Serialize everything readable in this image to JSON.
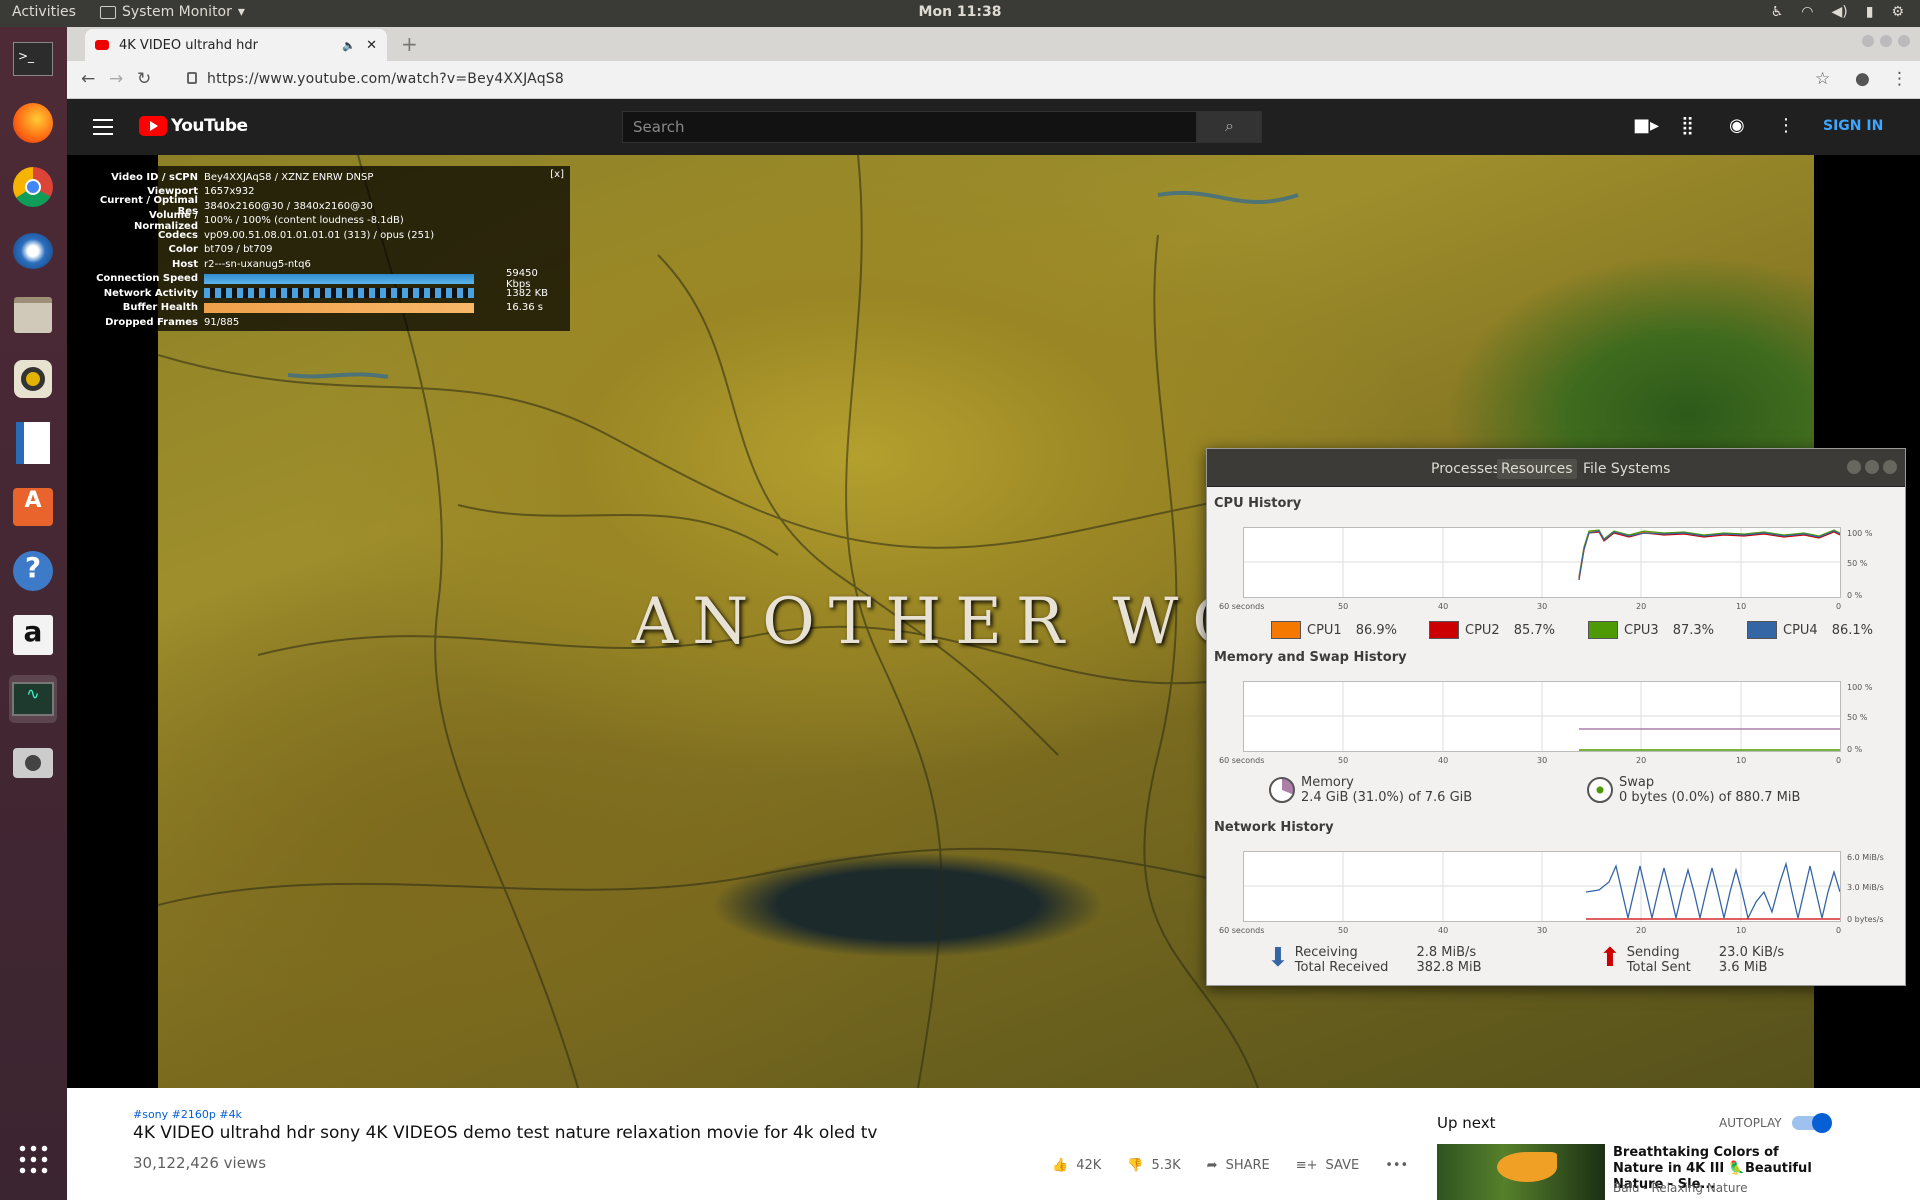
{
  "topbar": {
    "activities": "Activities",
    "app_name": "System Monitor",
    "clock": "Mon 11:38"
  },
  "launcher": {
    "items": [
      "terminal-icon",
      "firefox-icon",
      "chrome-icon",
      "thunderbird-icon",
      "files-icon",
      "rhythmbox-icon",
      "writer-icon",
      "software-icon",
      "help-icon",
      "amazon-icon",
      "system-monitor-icon",
      "screenshot-icon",
      "apps-grid-icon"
    ]
  },
  "browser": {
    "tab_title": "4K VIDEO ultrahd hdr",
    "new_tab": "+",
    "url": "https://www.youtube.com/watch?v=Bey4XXJAqS8"
  },
  "youtube": {
    "logo_text": "YouTube",
    "search_placeholder": "Search",
    "sign_in": "SIGN IN"
  },
  "video": {
    "overlay_title": "ANOTHER WO"
  },
  "stats": {
    "close": "[x]",
    "rows": [
      {
        "k": "Video ID / sCPN",
        "v": "Bey4XXJAqS8 / XZNZ ENRW DNSP"
      },
      {
        "k": "Viewport",
        "v": "1657x932"
      },
      {
        "k": "Current / Optimal Res",
        "v": "3840x2160@30 / 3840x2160@30"
      },
      {
        "k": "Volume / Normalized",
        "v": "100% / 100% (content loudness -8.1dB)"
      },
      {
        "k": "Codecs",
        "v": "vp09.00.51.08.01.01.01.01 (313) / opus (251)"
      },
      {
        "k": "Color",
        "v": "bt709 / bt709"
      },
      {
        "k": "Host",
        "v": "r2---sn-uxanug5-ntq6"
      },
      {
        "k": "Connection Speed",
        "v": "59450 Kbps"
      },
      {
        "k": "Network Activity",
        "v": "1382 KB"
      },
      {
        "k": "Buffer Health",
        "v": "16.36 s"
      },
      {
        "k": "Dropped Frames",
        "v": "91/885"
      }
    ]
  },
  "sysmon": {
    "tabs": [
      "Processes",
      "Resources",
      "File Systems"
    ],
    "cpu_title": "CPU History",
    "mem_title": "Memory and Swap History",
    "net_title": "Network History",
    "x_ticks": [
      "60 seconds",
      "50",
      "40",
      "30",
      "20",
      "10",
      "0"
    ],
    "pct_ticks": [
      "100 %",
      "50 %",
      "0 %"
    ],
    "net_ticks": [
      "6.0 MiB/s",
      "3.0 MiB/s",
      "0 bytes/s"
    ],
    "cpus": [
      {
        "label": "CPU1",
        "value": "86.9%",
        "color": "#f57900"
      },
      {
        "label": "CPU2",
        "value": "85.7%",
        "color": "#cc0000"
      },
      {
        "label": "CPU3",
        "value": "87.3%",
        "color": "#4e9a06"
      },
      {
        "label": "CPU4",
        "value": "86.1%",
        "color": "#3465a4"
      }
    ],
    "memory": {
      "label": "Memory",
      "value": "2.4 GiB (31.0%) of 7.6 GiB"
    },
    "swap": {
      "label": "Swap",
      "value": "0 bytes (0.0%) of 880.7 MiB"
    },
    "receiving": {
      "label": "Receiving",
      "rate": "2.8 MiB/s",
      "total_label": "Total Received",
      "total": "382.8 MiB"
    },
    "sending": {
      "label": "Sending",
      "rate": "23.0 KiB/s",
      "total_label": "Total Sent",
      "total": "3.6 MiB"
    }
  },
  "below": {
    "tags": "#sony #2160p #4k",
    "title": "4K VIDEO ultrahd hdr sony 4K VIDEOS demo test nature relaxation movie for 4k oled tv",
    "views": "30,122,426 views",
    "likes": "42K",
    "dislikes": "5.3K",
    "share": "SHARE",
    "save": "SAVE",
    "more": "•••",
    "up_next": "Up next",
    "autoplay": "AUTOPLAY",
    "next_title": "Breathtaking Colors of Nature in 4K III 🦜Beautiful Nature - Sle...",
    "next_channel": "Balu - Relaxing Nature"
  }
}
